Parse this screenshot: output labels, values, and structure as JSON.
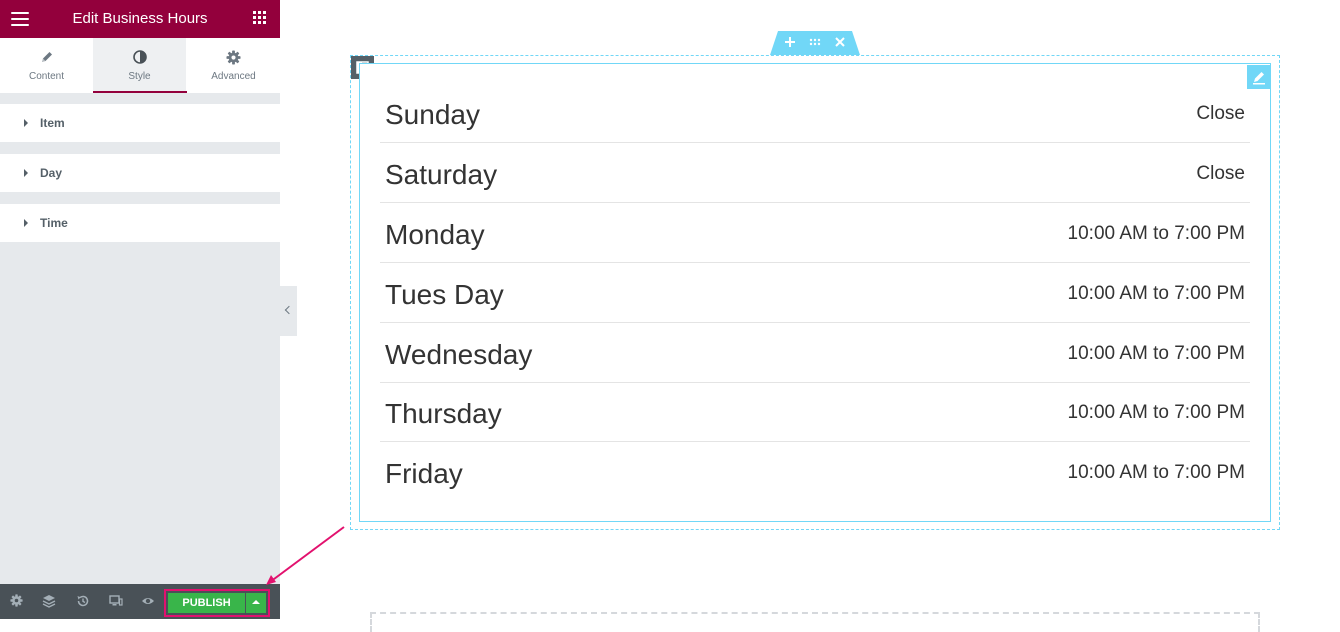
{
  "sidebar": {
    "title": "Edit Business Hours",
    "tabs": [
      {
        "label": "Content",
        "icon": "pencil-icon"
      },
      {
        "label": "Style",
        "icon": "half-circle-icon"
      },
      {
        "label": "Advanced",
        "icon": "gear-icon"
      }
    ],
    "active_tab": "Style",
    "sections": [
      {
        "label": "Item"
      },
      {
        "label": "Day"
      },
      {
        "label": "Time"
      }
    ],
    "footer": {
      "icons": [
        "settings-icon",
        "layers-icon",
        "history-icon",
        "responsive-icon",
        "preview-eye-icon"
      ],
      "publish_label": "PUBLISH"
    }
  },
  "business_hours": [
    {
      "day": "Sunday",
      "time": "Close"
    },
    {
      "day": "Saturday",
      "time": "Close"
    },
    {
      "day": "Monday",
      "time": "10:00 AM to 7:00 PM"
    },
    {
      "day": "Tues Day",
      "time": "10:00 AM to 7:00 PM"
    },
    {
      "day": "Wednesday",
      "time": "10:00 AM to 7:00 PM"
    },
    {
      "day": "Thursday",
      "time": "10:00 AM to 7:00 PM"
    },
    {
      "day": "Friday",
      "time": "10:00 AM to 7:00 PM"
    }
  ],
  "colors": {
    "brand": "#93003c",
    "publish": "#39b54a",
    "highlight": "#e2116e",
    "editor_accent": "#71d7f7"
  }
}
